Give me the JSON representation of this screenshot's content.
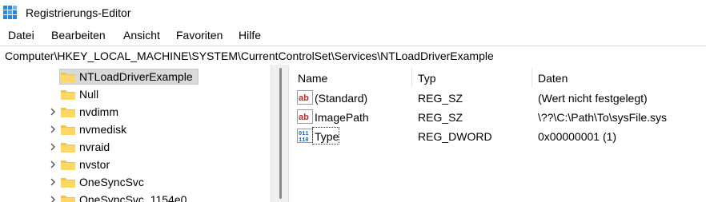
{
  "window": {
    "title": "Registrierungs-Editor",
    "accent": "#0078d4"
  },
  "menu": [
    "Datei",
    "Bearbeiten",
    "Ansicht",
    "Favoriten",
    "Hilfe"
  ],
  "address": "Computer\\HKEY_LOCAL_MACHINE\\SYSTEM\\CurrentControlSet\\Services\\NTLoadDriverExample",
  "tree": {
    "items": [
      {
        "label": "NTLoadDriverExample",
        "selected": true,
        "expandable": false
      },
      {
        "label": "Null",
        "selected": false,
        "expandable": false
      },
      {
        "label": "nvdimm",
        "selected": false,
        "expandable": true
      },
      {
        "label": "nvmedisk",
        "selected": false,
        "expandable": true
      },
      {
        "label": "nvraid",
        "selected": false,
        "expandable": true
      },
      {
        "label": "nvstor",
        "selected": false,
        "expandable": true
      },
      {
        "label": "OneSyncSvc",
        "selected": false,
        "expandable": true
      },
      {
        "label": "OneSyncSvc_1154e0",
        "selected": false,
        "expandable": true
      }
    ]
  },
  "list": {
    "columns": [
      "Name",
      "Typ",
      "Daten"
    ],
    "rows": [
      {
        "name": "(Standard)",
        "type": "REG_SZ",
        "data": "(Wert nicht festgelegt)",
        "icon": "string-value-icon"
      },
      {
        "name": "ImagePath",
        "type": "REG_SZ",
        "data": "\\??\\C:\\Path\\To\\sysFile.sys",
        "icon": "string-value-icon"
      },
      {
        "name": "Type",
        "type": "REG_DWORD",
        "data": "0x00000001 (1)",
        "icon": "binary-value-icon"
      }
    ]
  }
}
